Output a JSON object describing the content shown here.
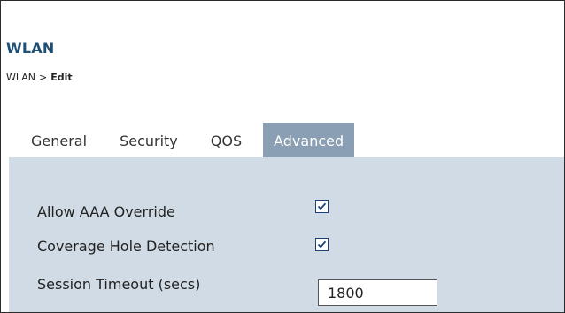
{
  "header": {
    "title": "WLAN"
  },
  "breadcrumb": {
    "parent": "WLAN",
    "separator": ">",
    "current": "Edit"
  },
  "tabs": [
    {
      "label": "General",
      "active": false
    },
    {
      "label": "Security",
      "active": false
    },
    {
      "label": "QOS",
      "active": false
    },
    {
      "label": "Advanced",
      "active": true
    }
  ],
  "advanced": {
    "allow_aaa_override": {
      "label": "Allow AAA Override",
      "checked": true
    },
    "coverage_hole_detection": {
      "label": "Coverage Hole Detection",
      "checked": true
    },
    "session_timeout": {
      "label": "Session Timeout (secs)",
      "value": "1800"
    }
  },
  "colors": {
    "title": "#1f4f73",
    "tab_active_bg": "#8a9fb4",
    "panel_bg": "#d1dbe5",
    "checkbox_border": "#1c3f78"
  }
}
